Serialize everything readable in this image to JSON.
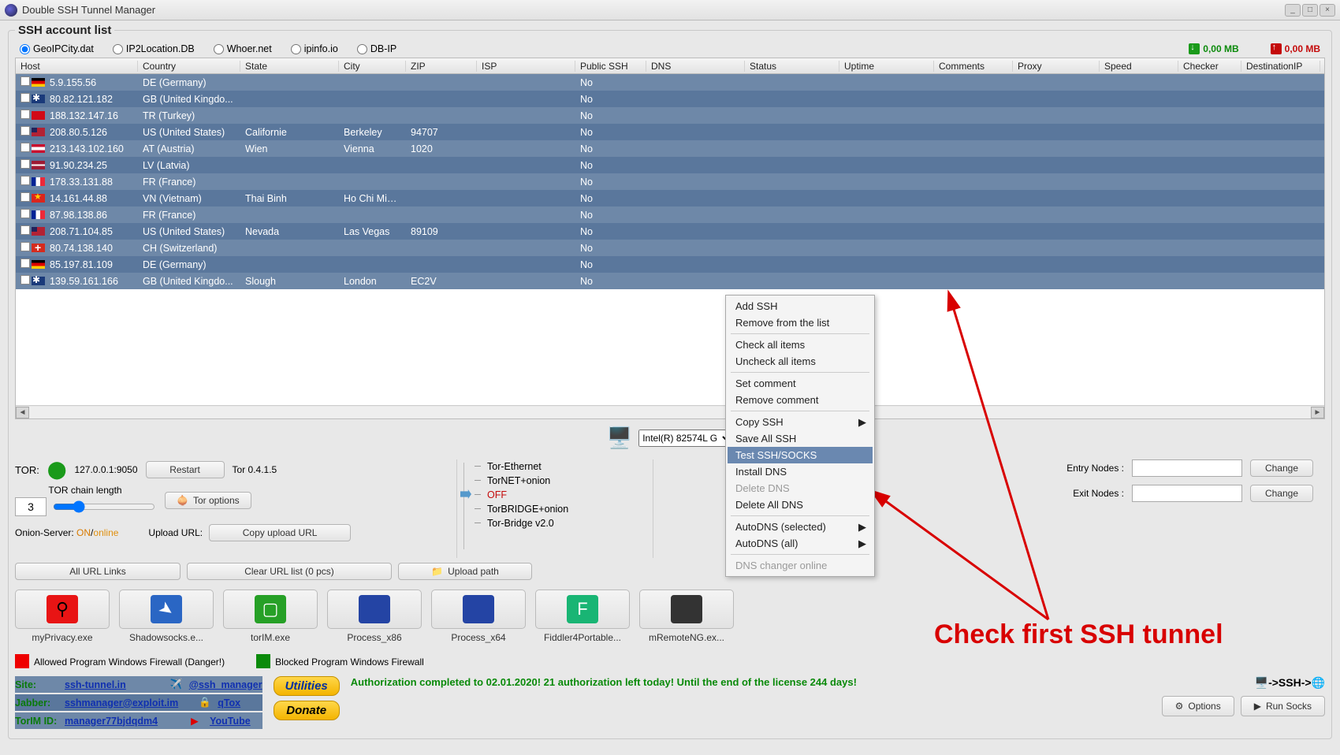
{
  "window": {
    "title": "Double SSH Tunnel Manager"
  },
  "group": {
    "legend": "SSH account list"
  },
  "geoip": {
    "opts": [
      "GeoIPCity.dat",
      "IP2Location.DB",
      "Whoer.net",
      "ipinfo.io",
      "DB-IP"
    ],
    "selected": 0
  },
  "traffic": {
    "down": "0,00 MB",
    "up": "0,00 MB"
  },
  "columns": [
    "Host",
    "Country",
    "State",
    "City",
    "ZIP",
    "ISP",
    "Public SSH",
    "DNS",
    "Status",
    "Uptime",
    "Comments",
    "Proxy",
    "Speed",
    "Checker",
    "DestinationIP"
  ],
  "rows": [
    {
      "flag": "de",
      "host": "5.9.155.56",
      "country": "DE (Germany)",
      "state": "",
      "city": "",
      "zip": "",
      "pssh": "No"
    },
    {
      "flag": "gb",
      "host": "80.82.121.182",
      "country": "GB (United Kingdo...",
      "state": "",
      "city": "",
      "zip": "",
      "pssh": "No"
    },
    {
      "flag": "tr",
      "host": "188.132.147.16",
      "country": "TR (Turkey)",
      "state": "",
      "city": "",
      "zip": "",
      "pssh": "No"
    },
    {
      "flag": "us",
      "host": "208.80.5.126",
      "country": "US (United States)",
      "state": "Californie",
      "city": "Berkeley",
      "zip": "94707",
      "pssh": "No"
    },
    {
      "flag": "at",
      "host": "213.143.102.160",
      "country": "AT (Austria)",
      "state": "Wien",
      "city": "Vienna",
      "zip": "1020",
      "pssh": "No"
    },
    {
      "flag": "lv",
      "host": "91.90.234.25",
      "country": "LV (Latvia)",
      "state": "",
      "city": "",
      "zip": "",
      "pssh": "No"
    },
    {
      "flag": "fr",
      "host": "178.33.131.88",
      "country": "FR (France)",
      "state": "",
      "city": "",
      "zip": "",
      "pssh": "No"
    },
    {
      "flag": "vn",
      "host": "14.161.44.88",
      "country": "VN (Vietnam)",
      "state": "Thai Binh",
      "city": "Ho Chi Minh...",
      "zip": "",
      "pssh": "No"
    },
    {
      "flag": "fr",
      "host": "87.98.138.86",
      "country": "FR (France)",
      "state": "",
      "city": "",
      "zip": "",
      "pssh": "No"
    },
    {
      "flag": "us",
      "host": "208.71.104.85",
      "country": "US (United States)",
      "state": "Nevada",
      "city": "Las Vegas",
      "zip": "89109",
      "pssh": "No"
    },
    {
      "flag": "ch",
      "host": "80.74.138.140",
      "country": "CH (Switzerland)",
      "state": "",
      "city": "",
      "zip": "",
      "pssh": "No"
    },
    {
      "flag": "de",
      "host": "85.197.81.109",
      "country": "DE (Germany)",
      "state": "",
      "city": "",
      "zip": "",
      "pssh": "No"
    },
    {
      "flag": "gb",
      "host": "139.59.161.166",
      "country": "GB (United Kingdo...",
      "state": "Slough",
      "city": "London",
      "zip": "EC2V",
      "pssh": "No"
    }
  ],
  "net": {
    "adapter": "Intel(R) 82574L G"
  },
  "tor": {
    "label": "TOR:",
    "addr": "127.0.0.1:9050",
    "restart": "Restart",
    "ver": "Tor 0.4.1.5",
    "chainlabel": "TOR chain length",
    "chain": "3",
    "toropt": "Tor options",
    "onion_label": "Onion-Server:",
    "onion_on": "ON",
    "onion_online": "online",
    "upload_label": "Upload URL:",
    "copy": "Copy upload URL"
  },
  "tree": {
    "items": [
      "Tor-Ethernet",
      "TorNET+onion",
      "OFF",
      "TorBRIDGE+onion",
      "Tor-Bridge v2.0"
    ]
  },
  "nodes": {
    "entry_lbl": "Entry Nodes :",
    "exit_lbl": "Exit Nodes :",
    "change": "Change"
  },
  "links": {
    "all": "All URL Links",
    "clear": "Clear URL list (0 pcs)",
    "upload": "Upload path"
  },
  "apps": [
    {
      "name": "myPrivacy.exe",
      "color": "red",
      "glyph": "⚲"
    },
    {
      "name": "Shadowsocks.e...",
      "color": "blue",
      "glyph": "➤"
    },
    {
      "name": "torIM.exe",
      "color": "green",
      "glyph": "▢"
    },
    {
      "name": "Process_x86",
      "color": "mon",
      "glyph": ""
    },
    {
      "name": "Process_x64",
      "color": "mon",
      "glyph": ""
    },
    {
      "name": "Fiddler4Portable...",
      "color": "teal",
      "glyph": "F"
    },
    {
      "name": "mRemoteNG.ex...",
      "color": "grey",
      "glyph": ""
    }
  ],
  "firewall": {
    "allowed": "Allowed Program Windows Firewall (Danger!)",
    "blocked": "Blocked Program Windows Firewall"
  },
  "footer": {
    "site_lbl": "Site:",
    "site": "ssh-tunnel.in",
    "jabber_lbl": "Jabber:",
    "jabber": "sshmanager@exploit.im",
    "torim_lbl": "TorIM ID:",
    "torim": "manager77bjdqdm4",
    "handle": "@ssh_manager",
    "qtox": "qTox",
    "youtube": "YouTube",
    "utilities": "Utilities",
    "donate": "Donate",
    "auth": "Authorization completed to 02.01.2020! 21 authorization left today! Until the end of the license 244 days!",
    "sshind": "->SSH->",
    "options": "Options",
    "run": "Run Socks"
  },
  "ctx": {
    "items": [
      {
        "t": "Add SSH"
      },
      {
        "t": "Remove from the list"
      },
      {
        "sep": true
      },
      {
        "t": "Check all items"
      },
      {
        "t": "Uncheck all items"
      },
      {
        "sep": true
      },
      {
        "t": "Set comment"
      },
      {
        "t": "Remove comment"
      },
      {
        "sep": true
      },
      {
        "t": "Copy SSH",
        "sub": true
      },
      {
        "t": "Save All SSH"
      },
      {
        "t": "Test SSH/SOCKS",
        "hl": true
      },
      {
        "t": "Install DNS"
      },
      {
        "t": "Delete DNS",
        "dis": true
      },
      {
        "t": "Delete All DNS"
      },
      {
        "sep": true
      },
      {
        "t": "AutoDNS (selected)",
        "sub": true
      },
      {
        "t": "AutoDNS (all)",
        "sub": true
      },
      {
        "sep": true
      },
      {
        "t": "DNS changer online",
        "dis": true
      }
    ]
  },
  "annot": "Check first SSH tunnel"
}
